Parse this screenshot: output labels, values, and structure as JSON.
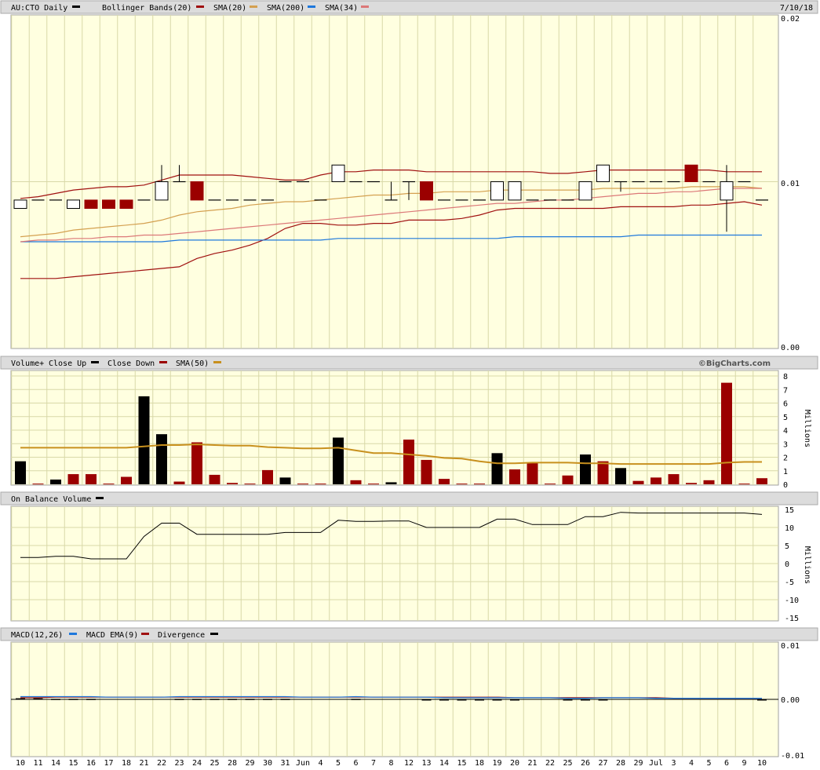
{
  "colors": {
    "panel_bg": "#ffffe0",
    "grid": "#d8d8a8",
    "header_bg": "#dcdcdc",
    "up": "#000000",
    "down": "#9b0000",
    "bollinger": "#a01010",
    "sma20": "#d4a050",
    "sma200": "#1e78dc",
    "sma34": "#dc7878",
    "vol_sma50": "#c8901e",
    "obv": "#000000",
    "macd": "#1e78dc",
    "macd_ema": "#a01010",
    "divergence": "#000000"
  },
  "price_panel": {
    "header": {
      "ticker": "AU:CTO Daily",
      "bollinger": "Bollinger Bands(20)",
      "sma20": "SMA(20)",
      "sma200": "SMA(200)",
      "sma34": "SMA(34)",
      "date": "7/10/18"
    },
    "y_ticks": [
      "0.02",
      "0.01",
      "0.00"
    ]
  },
  "volume_panel": {
    "header": {
      "title": "Volume+",
      "close_up": "Close Up",
      "close_down": "Close Down",
      "sma50": "SMA(50)"
    },
    "copyright": "©BigCharts.com",
    "y_ticks": [
      "8",
      "7",
      "6",
      "5",
      "4",
      "3",
      "2",
      "1",
      "0"
    ],
    "unit": "Millions"
  },
  "obv_panel": {
    "header": {
      "title": "On Balance Volume"
    },
    "y_ticks": [
      "15",
      "10",
      "5",
      "0",
      "-5",
      "-10",
      "-15"
    ],
    "unit": "Millions"
  },
  "macd_panel": {
    "header": {
      "macd": "MACD(12,26)",
      "ema": "MACD EMA(9)",
      "divergence": "Divergence"
    },
    "y_ticks": [
      "0.01",
      "0.00",
      "-0.01"
    ]
  },
  "x_labels": [
    "10",
    "11",
    "14",
    "15",
    "16",
    "17",
    "18",
    "21",
    "22",
    "23",
    "24",
    "25",
    "28",
    "29",
    "30",
    "31",
    "Jun",
    "4",
    "5",
    "6",
    "7",
    "8",
    "12",
    "13",
    "14",
    "15",
    "18",
    "19",
    "20",
    "21",
    "22",
    "25",
    "26",
    "27",
    "28",
    "29",
    "Jul",
    "3",
    "4",
    "5",
    "6",
    "9",
    "10"
  ],
  "chart_data": [
    {
      "type": "candlestick",
      "title": "AU:CTO Daily",
      "ylim": [
        0,
        0.02
      ],
      "x": [
        "May 10",
        "May 11",
        "May 14",
        "May 15",
        "May 16",
        "May 17",
        "May 18",
        "May 21",
        "May 22",
        "May 23",
        "May 24",
        "May 25",
        "May 28",
        "May 29",
        "May 30",
        "May 31",
        "Jun 1",
        "Jun 4",
        "Jun 5",
        "Jun 6",
        "Jun 7",
        "Jun 8",
        "Jun 12",
        "Jun 13",
        "Jun 14",
        "Jun 15",
        "Jun 18",
        "Jun 19",
        "Jun 20",
        "Jun 21",
        "Jun 22",
        "Jun 25",
        "Jun 26",
        "Jun 27",
        "Jun 28",
        "Jun 29",
        "Jul 2",
        "Jul 3",
        "Jul 4",
        "Jul 5",
        "Jul 6",
        "Jul 9",
        "Jul 10"
      ],
      "open": [
        0.0084,
        0.0089,
        0.0089,
        0.0084,
        0.0089,
        0.0089,
        0.0089,
        0.0089,
        0.0089,
        0.01,
        0.01,
        0.0089,
        0.0089,
        0.0089,
        0.0089,
        0.01,
        0.01,
        0.0089,
        0.01,
        0.01,
        0.01,
        0.0089,
        0.01,
        0.01,
        0.0089,
        0.0089,
        0.0089,
        0.0089,
        0.0089,
        0.0089,
        0.0089,
        0.0089,
        0.0089,
        0.01,
        0.01,
        0.01,
        0.01,
        0.01,
        0.011,
        0.01,
        0.0089,
        0.01,
        0.0089
      ],
      "high": [
        0.0089,
        0.0089,
        0.0089,
        0.0089,
        0.0089,
        0.0089,
        0.0089,
        0.0089,
        0.011,
        0.011,
        0.01,
        0.0089,
        0.0089,
        0.0089,
        0.0089,
        0.01,
        0.01,
        0.0089,
        0.011,
        0.01,
        0.01,
        0.01,
        0.01,
        0.01,
        0.0089,
        0.0089,
        0.0089,
        0.01,
        0.01,
        0.0089,
        0.0089,
        0.0089,
        0.01,
        0.011,
        0.01,
        0.01,
        0.01,
        0.01,
        0.011,
        0.01,
        0.011,
        0.01,
        0.0089
      ],
      "low": [
        0.0084,
        0.0089,
        0.0089,
        0.0084,
        0.0084,
        0.0084,
        0.0084,
        0.0089,
        0.0089,
        0.01,
        0.0089,
        0.0089,
        0.0089,
        0.0089,
        0.0089,
        0.01,
        0.01,
        0.0089,
        0.01,
        0.01,
        0.01,
        0.0089,
        0.0089,
        0.0089,
        0.0089,
        0.0089,
        0.0089,
        0.0089,
        0.0089,
        0.0089,
        0.0089,
        0.0089,
        0.0089,
        0.01,
        0.0094,
        0.01,
        0.01,
        0.01,
        0.01,
        0.01,
        0.007,
        0.01,
        0.0089
      ],
      "close": [
        0.0089,
        0.0089,
        0.0089,
        0.0089,
        0.0084,
        0.0084,
        0.0084,
        0.0089,
        0.01,
        0.01,
        0.0089,
        0.0089,
        0.0089,
        0.0089,
        0.0089,
        0.01,
        0.01,
        0.0089,
        0.011,
        0.01,
        0.01,
        0.0089,
        0.01,
        0.0089,
        0.0089,
        0.0089,
        0.0089,
        0.01,
        0.01,
        0.0089,
        0.0089,
        0.0089,
        0.01,
        0.011,
        0.01,
        0.01,
        0.01,
        0.01,
        0.01,
        0.01,
        0.01,
        0.01,
        0.0089
      ],
      "series": [
        {
          "name": "Bollinger Bands(20)",
          "values": [
            0.009,
            0.0091,
            0.0093,
            0.0095,
            0.0096,
            0.0097,
            0.0097,
            0.0098,
            0.0101,
            0.0104,
            0.0104,
            0.0104,
            0.0104,
            0.0103,
            0.0102,
            0.0101,
            0.0101,
            0.0104,
            0.0106,
            0.0106,
            0.0107,
            0.0107,
            0.0107,
            0.0106,
            0.0106,
            0.0106,
            0.0106,
            0.0106,
            0.0106,
            0.0106,
            0.0105,
            0.0105,
            0.0106,
            0.0107,
            0.0107,
            0.0107,
            0.0107,
            0.0107,
            0.0107,
            0.0107,
            0.0106,
            0.0106,
            0.0106
          ]
        },
        {
          "name": "Bollinger Bands(20) lower",
          "values": [
            0.0042,
            0.0042,
            0.0042,
            0.0043,
            0.0044,
            0.0045,
            0.0046,
            0.0047,
            0.0048,
            0.0049,
            0.0054,
            0.0057,
            0.0059,
            0.0062,
            0.0066,
            0.0072,
            0.0075,
            0.0075,
            0.0074,
            0.0074,
            0.0075,
            0.0075,
            0.0077,
            0.0077,
            0.0077,
            0.0078,
            0.008,
            0.0083,
            0.0084,
            0.0084,
            0.0084,
            0.0084,
            0.0084,
            0.0084,
            0.0085,
            0.0085,
            0.0085,
            0.0085,
            0.0086,
            0.0086,
            0.0087,
            0.0088,
            0.0086
          ]
        },
        {
          "name": "SMA(20)",
          "values": [
            0.0067,
            0.0068,
            0.0069,
            0.0071,
            0.0072,
            0.0073,
            0.0074,
            0.0075,
            0.0077,
            0.008,
            0.0082,
            0.0083,
            0.0084,
            0.0086,
            0.0087,
            0.0088,
            0.0088,
            0.0089,
            0.009,
            0.0091,
            0.0092,
            0.0092,
            0.0093,
            0.0093,
            0.0094,
            0.0094,
            0.0094,
            0.0095,
            0.0095,
            0.0095,
            0.0095,
            0.0095,
            0.0095,
            0.0096,
            0.0096,
            0.0096,
            0.0096,
            0.0096,
            0.0097,
            0.0097,
            0.0097,
            0.0097,
            0.0096
          ]
        },
        {
          "name": "SMA(200)",
          "values": [
            0.0064,
            0.0064,
            0.0064,
            0.0064,
            0.0064,
            0.0064,
            0.0064,
            0.0064,
            0.0064,
            0.0065,
            0.0065,
            0.0065,
            0.0065,
            0.0065,
            0.0065,
            0.0065,
            0.0065,
            0.0065,
            0.0066,
            0.0066,
            0.0066,
            0.0066,
            0.0066,
            0.0066,
            0.0066,
            0.0066,
            0.0066,
            0.0066,
            0.0067,
            0.0067,
            0.0067,
            0.0067,
            0.0067,
            0.0067,
            0.0067,
            0.0068,
            0.0068,
            0.0068,
            0.0068,
            0.0068,
            0.0068,
            0.0068,
            0.0068
          ]
        },
        {
          "name": "SMA(34)",
          "values": [
            0.0064,
            0.0065,
            0.0065,
            0.0066,
            0.0066,
            0.0067,
            0.0067,
            0.0068,
            0.0068,
            0.0069,
            0.007,
            0.0071,
            0.0072,
            0.0073,
            0.0074,
            0.0075,
            0.0076,
            0.0077,
            0.0078,
            0.0079,
            0.008,
            0.0081,
            0.0082,
            0.0083,
            0.0084,
            0.0085,
            0.0086,
            0.0087,
            0.0087,
            0.0088,
            0.0089,
            0.0089,
            0.009,
            0.0091,
            0.0092,
            0.0093,
            0.0093,
            0.0094,
            0.0094,
            0.0095,
            0.0096,
            0.0096,
            0.0096
          ]
        }
      ]
    },
    {
      "type": "bar",
      "title": "Volume+",
      "ylabel": "Millions",
      "ylim": [
        0,
        8
      ],
      "values": [
        1.7,
        0.05,
        0.35,
        0.75,
        0.75,
        0.05,
        0.55,
        6.5,
        3.7,
        0.2,
        3.1,
        0.7,
        0.1,
        0.05,
        1.05,
        0.5,
        0.05,
        0.05,
        3.45,
        0.3,
        0.05,
        0.15,
        3.3,
        1.8,
        0.4,
        0.05,
        0.05,
        2.3,
        1.1,
        1.6,
        0.05,
        0.65,
        2.2,
        1.7,
        1.2,
        0.25,
        0.5,
        0.75,
        0.1,
        0.3,
        7.5,
        0.05,
        0.45
      ],
      "direction": [
        "up",
        "down",
        "up",
        "down",
        "down",
        "down",
        "down",
        "up",
        "up",
        "down",
        "down",
        "down",
        "down",
        "down",
        "down",
        "up",
        "down",
        "down",
        "up",
        "down",
        "down",
        "up",
        "down",
        "down",
        "down",
        "down",
        "down",
        "up",
        "down",
        "down",
        "down",
        "down",
        "up",
        "down",
        "up",
        "down",
        "down",
        "down",
        "down",
        "down",
        "down",
        "down",
        "down"
      ],
      "series": [
        {
          "name": "SMA(50)",
          "values": [
            2.7,
            2.7,
            2.7,
            2.7,
            2.7,
            2.7,
            2.7,
            2.8,
            2.9,
            2.9,
            2.95,
            2.9,
            2.85,
            2.85,
            2.75,
            2.7,
            2.65,
            2.65,
            2.7,
            2.5,
            2.3,
            2.3,
            2.2,
            2.1,
            1.95,
            1.9,
            1.7,
            1.55,
            1.55,
            1.6,
            1.6,
            1.6,
            1.55,
            1.55,
            1.5,
            1.5,
            1.5,
            1.5,
            1.5,
            1.5,
            1.6,
            1.65,
            1.65
          ]
        }
      ]
    },
    {
      "type": "line",
      "title": "On Balance Volume",
      "ylabel": "Millions",
      "ylim": [
        -15,
        15
      ],
      "series": [
        {
          "name": "On Balance Volume",
          "values": [
            1.7,
            1.7,
            2.0,
            2.0,
            1.3,
            1.3,
            1.3,
            7.5,
            11.2,
            11.2,
            8.1,
            8.1,
            8.1,
            8.1,
            8.1,
            8.6,
            8.6,
            8.6,
            12.0,
            11.7,
            11.7,
            11.8,
            11.8,
            10.0,
            10.0,
            10.0,
            10.0,
            12.3,
            12.3,
            10.8,
            10.8,
            10.8,
            13.0,
            13.0,
            14.2,
            14.0,
            14.0,
            14.0,
            14.0,
            14.0,
            14.0,
            14.0,
            13.6
          ]
        }
      ]
    },
    {
      "type": "line",
      "title": "MACD(12,26)",
      "ylim": [
        -0.01,
        0.01
      ],
      "series": [
        {
          "name": "MACD(12,26)",
          "values": [
            0.0005,
            0.0005,
            0.0005,
            0.0005,
            0.0005,
            0.0004,
            0.0004,
            0.0004,
            0.0004,
            0.0005,
            0.0005,
            0.0005,
            0.0005,
            0.0005,
            0.0005,
            0.0005,
            0.0004,
            0.0004,
            0.0004,
            0.0005,
            0.0004,
            0.0004,
            0.0004,
            0.0004,
            0.0003,
            0.0003,
            0.0003,
            0.0003,
            0.0003,
            0.0003,
            0.0003,
            0.0002,
            0.0002,
            0.0003,
            0.0003,
            0.0003,
            0.0002,
            0.0002,
            0.0002,
            0.0002,
            0.0002,
            0.0002,
            0.0002
          ]
        },
        {
          "name": "MACD EMA(9)",
          "values": [
            0.0003,
            0.0003,
            0.0004,
            0.0004,
            0.0004,
            0.0004,
            0.0004,
            0.0004,
            0.0004,
            0.0004,
            0.0004,
            0.0004,
            0.0004,
            0.0004,
            0.0004,
            0.0004,
            0.0004,
            0.0004,
            0.0004,
            0.0004,
            0.0004,
            0.0004,
            0.0004,
            0.0004,
            0.0004,
            0.0004,
            0.0004,
            0.0004,
            0.0003,
            0.0003,
            0.0003,
            0.0003,
            0.0003,
            0.0003,
            0.0003,
            0.0003,
            0.0003,
            0.0002,
            0.0002,
            0.0002,
            0.0002,
            0.0002,
            0.0002
          ]
        },
        {
          "name": "Divergence",
          "values": [
            0.0002,
            0.0002,
            0.0001,
            0.0001,
            0.0001,
            0,
            0,
            0,
            0,
            0.0001,
            0.0001,
            0.0001,
            0.0001,
            0.0001,
            0.0001,
            0.0001,
            0,
            0,
            0,
            0.0001,
            0,
            0,
            0,
            -0.0001,
            -0.0001,
            -0.0001,
            -0.0001,
            -0.0001,
            -0.0001,
            0,
            0,
            -0.0001,
            -0.0001,
            -0.0001,
            0,
            0,
            0,
            0,
            0,
            0,
            0,
            0,
            -0.0001
          ]
        }
      ]
    }
  ]
}
